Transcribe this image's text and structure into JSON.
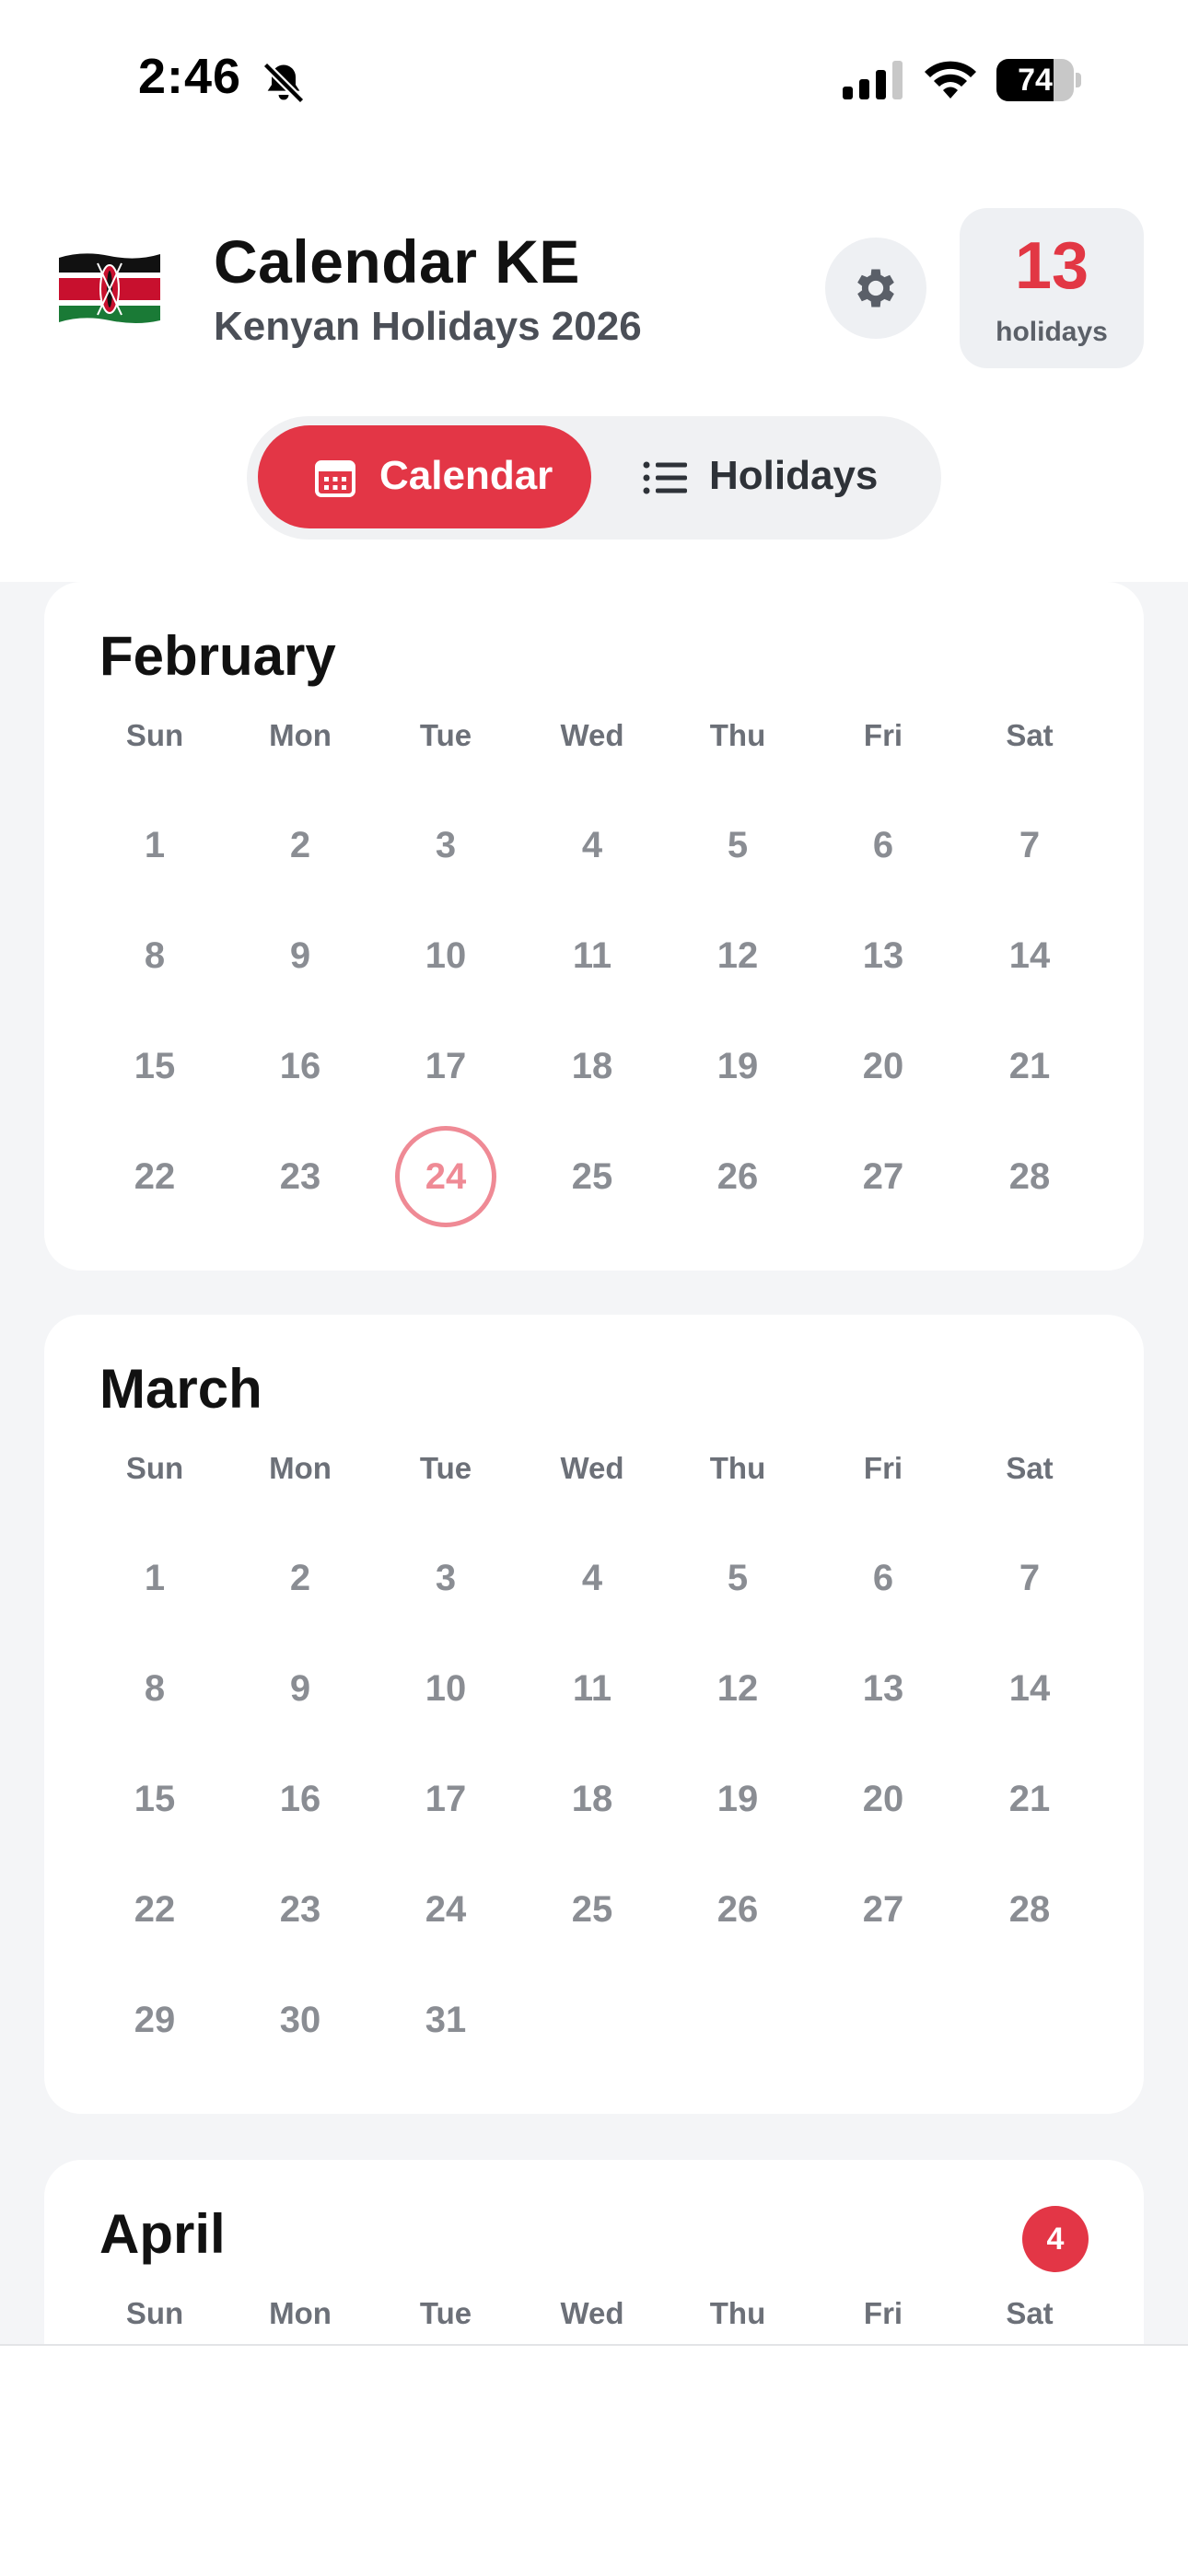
{
  "status_bar": {
    "time": "2:46",
    "battery": "74",
    "battery_level": 0.74
  },
  "header": {
    "title": "Calendar KE",
    "subtitle": "Kenyan Holidays 2026",
    "holiday_count": "13",
    "holiday_count_label": "holidays",
    "tabs": [
      {
        "label": "Calendar",
        "active": true,
        "icon": "calendar-icon"
      },
      {
        "label": "Holidays",
        "active": false,
        "icon": "list-icon"
      }
    ]
  },
  "colors": {
    "accent": "#e33646",
    "today_ring": "#ef8a95",
    "day_text": "#8a8d93"
  },
  "weekdays": [
    "Sun",
    "Mon",
    "Tue",
    "Wed",
    "Thu",
    "Fri",
    "Sat"
  ],
  "months": [
    {
      "name": "February",
      "first_weekday": 0,
      "days": 28,
      "today": 24,
      "badge": ""
    },
    {
      "name": "March",
      "first_weekday": 0,
      "days": 31,
      "today": null,
      "badge": ""
    },
    {
      "name": "April",
      "first_weekday": 3,
      "days": 30,
      "today": null,
      "badge": "4"
    }
  ]
}
